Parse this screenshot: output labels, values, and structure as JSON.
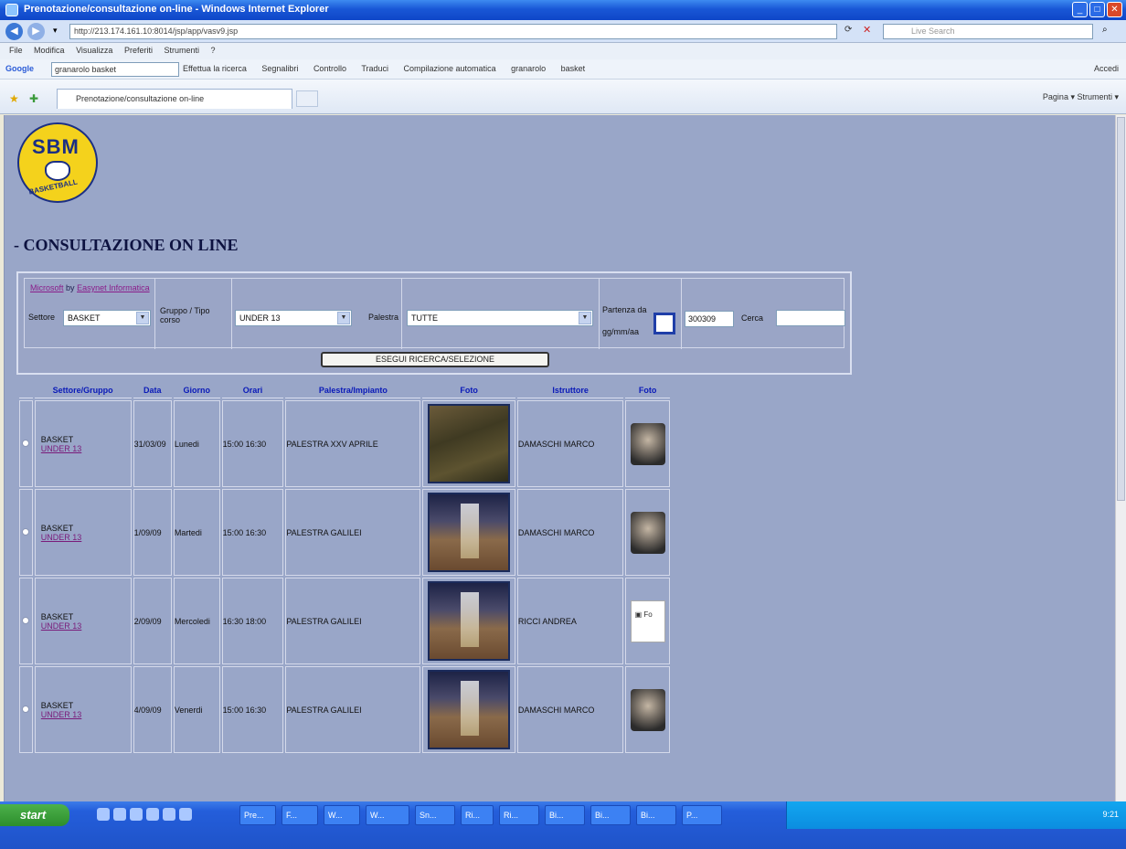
{
  "window": {
    "title": "Prenotazione/consultazione on-line - Windows Internet Explorer",
    "url": "http://213.174.161.10:8014/jsp/app/vasv9.jsp",
    "search_placeholder": "Live Search"
  },
  "menu": [
    "File",
    "Modifica",
    "Visualizza",
    "Preferiti",
    "Strumenti",
    "?"
  ],
  "google_toolbar": {
    "label": "Google",
    "search_value": "granarolo basket",
    "items": [
      "Effettua la ricerca",
      "Segnalibri",
      "Controllo",
      "Traduci",
      "Compilazione automatica",
      "granarolo",
      "basket"
    ],
    "right_label": "Accedi"
  },
  "tab": {
    "label": "Prenotazione/consultazione on-line",
    "tools": "Pagina ▾  Strumenti ▾"
  },
  "page": {
    "title": "- CONSULTAZIONE ON LINE",
    "logo_text": "SBM",
    "logo_subtext": "BASKETBALL"
  },
  "filter": {
    "credit_prefix": "by",
    "credit_link1": "Microsoft",
    "credit_link2": "Easynet Informatica",
    "settore_label": "Settore",
    "settore_value": "BASKET",
    "gruppo_label": "Gruppo / Tipo corso",
    "gruppo_value": "UNDER 13",
    "palestra_label": "Palestra",
    "palestra_value": "TUTTE",
    "partenza_label": "Partenza da gg/mm/aa",
    "data_value": "300309",
    "cerca_label": "Cerca",
    "cerca_value": "",
    "execute_label": "ESEGUI RICERCA/SELEZIONE"
  },
  "table": {
    "headers": [
      "Settore/Gruppo",
      "Data",
      "Giorno",
      "Orari",
      "Palestra/Impianto",
      "Foto",
      "Istruttore",
      "Foto"
    ],
    "rows": [
      {
        "settore": "BASKET",
        "gruppo": "UNDER 13",
        "data": "31/03/09",
        "giorno": "Lunedi",
        "orari": "15:00 16:30",
        "palestra": "PALESTRA XXV APRILE",
        "istruttore": "DAMASCHI MARCO"
      },
      {
        "settore": "BASKET",
        "gruppo": "UNDER 13",
        "data": "1/09/09",
        "giorno": "Martedi",
        "orari": "15:00 16:30",
        "palestra": "PALESTRA GALILEI",
        "istruttore": "DAMASCHI MARCO"
      },
      {
        "settore": "BASKET",
        "gruppo": "UNDER 13",
        "data": "2/09/09",
        "giorno": "Mercoledi",
        "orari": "16:30 18:00",
        "palestra": "PALESTRA GALILEI",
        "istruttore": "RICCI ANDREA"
      },
      {
        "settore": "BASKET",
        "gruppo": "UNDER 13",
        "data": "4/09/09",
        "giorno": "Venerdi",
        "orari": "15:00 16:30",
        "palestra": "PALESTRA GALILEI",
        "istruttore": "DAMASCHI MARCO"
      }
    ]
  },
  "taskbar": {
    "start_label": "start",
    "buttons": [
      "Pre...",
      "F...",
      "W...",
      "W...",
      "Sn...",
      "Ri...",
      "Ri...",
      "Bi...",
      "Bi...",
      "Bi...",
      "P..."
    ],
    "clock": "9:21"
  }
}
